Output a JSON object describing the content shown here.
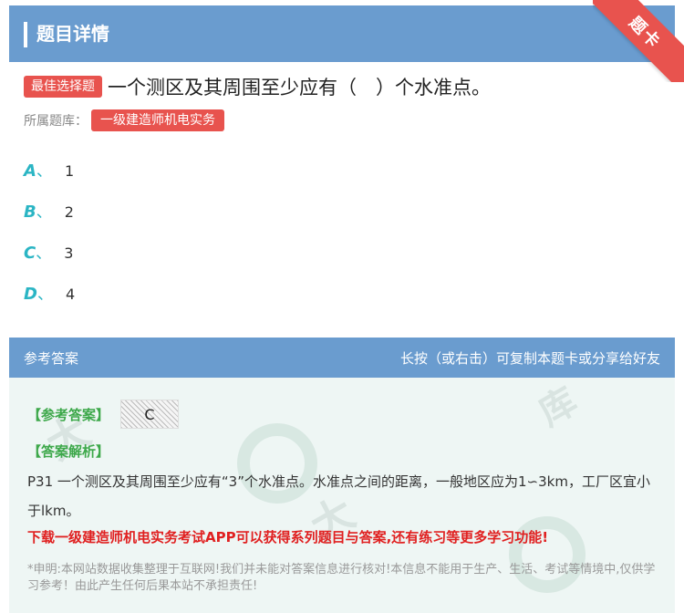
{
  "header": {
    "title": "题目详情",
    "ribbon": "题卡"
  },
  "question": {
    "type_tag": "最佳选择题",
    "text": "一个测区及其周围至少应有（　）个水准点。",
    "library_label": "所属题库：",
    "library_name": "一级建造师机电实务"
  },
  "options": [
    {
      "letter": "A",
      "sep": "、",
      "text": "1"
    },
    {
      "letter": "B",
      "sep": "、",
      "text": "2"
    },
    {
      "letter": "C",
      "sep": "、",
      "text": "3"
    },
    {
      "letter": "D",
      "sep": "、",
      "text": "4"
    }
  ],
  "answer": {
    "header_left": "参考答案",
    "header_right": "长按（或右击）可复制本题卡或分享给好友",
    "ref_label": "【参考答案】",
    "ref_value": "C",
    "analysis_label": "【答案解析】",
    "analysis_text": "P31 一个测区及其周围至少应有“3”个水准点。水准点之间的距离，一般地区应为1∽3km，工厂区宜小于lkm。",
    "promo": "下载一级建造师机电实务考试APP可以获得系列题目与答案,还有练习等更多学习功能!",
    "disclaimer": "*申明:本网站数据收集整理于互联网!我们并未能对答案信息进行核对!本信息不能用于生产、生活、考试等情境中,仅供学习参考！由此产生任何后果本站不承担责任!"
  },
  "colors": {
    "header_bg": "#6a9ccf",
    "tag_red": "#e8534e",
    "option_letter": "#2bb5c4",
    "answer_green": "#3da84a",
    "promo_red": "#e02020"
  }
}
